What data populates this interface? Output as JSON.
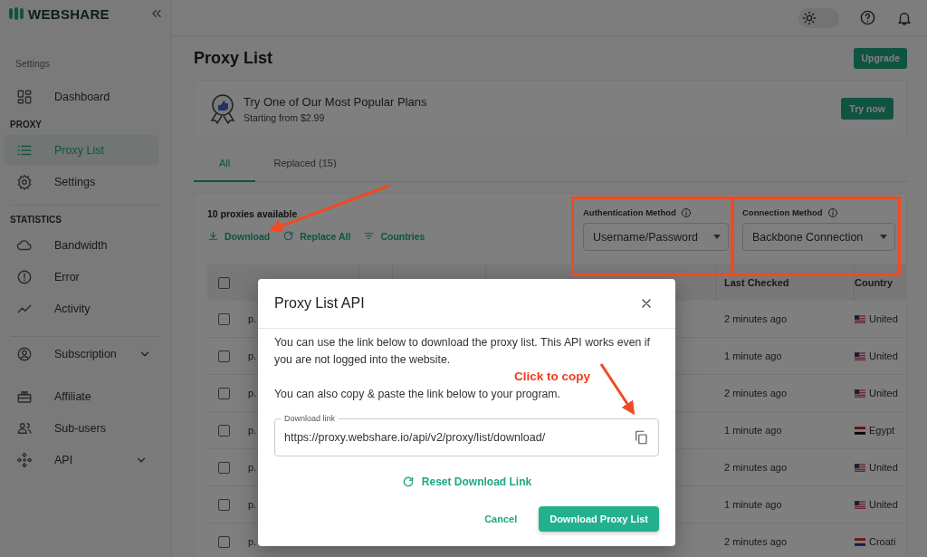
{
  "brand": {
    "name": "WEBSHARE"
  },
  "sidebar": {
    "heading": "Settings",
    "sections": [
      {
        "divider_above": false,
        "items": [
          {
            "label": "Dashboard",
            "kind": "dashboard",
            "selected": false,
            "expandable": false
          }
        ]
      },
      {
        "title": "PROXY",
        "divider_above": false,
        "items": [
          {
            "label": "Proxy List",
            "kind": "list",
            "selected": true,
            "expandable": false
          },
          {
            "label": "Settings",
            "kind": "gear",
            "selected": false,
            "expandable": false
          }
        ]
      },
      {
        "title": "STATISTICS",
        "divider_above": true,
        "items": [
          {
            "label": "Bandwidth",
            "kind": "cloud",
            "selected": false,
            "expandable": false
          },
          {
            "label": "Error",
            "kind": "alert",
            "selected": false,
            "expandable": false
          },
          {
            "label": "Activity",
            "kind": "trend",
            "selected": false,
            "expandable": false
          }
        ]
      },
      {
        "divider_above": true,
        "items": [
          {
            "label": "Subscription",
            "kind": "user",
            "selected": false,
            "expandable": true
          }
        ]
      },
      {
        "divider_above": false,
        "items": [
          {
            "label": "Affiliate",
            "kind": "gift",
            "selected": false,
            "expandable": false
          },
          {
            "label": "Sub-users",
            "kind": "users",
            "selected": false,
            "expandable": false
          },
          {
            "label": "API",
            "kind": "api",
            "selected": false,
            "expandable": true
          }
        ]
      }
    ]
  },
  "topbar": {
    "dark_mode": false
  },
  "page": {
    "title": "Proxy List",
    "upgrade_button": "Upgrade"
  },
  "promo": {
    "title": "Try One of Our Most Popular Plans",
    "subtitle": "Starting from $2.99",
    "button": "Try now"
  },
  "tabs": [
    {
      "label": "All",
      "selected": true
    },
    {
      "label": "Replaced (15)",
      "selected": false
    }
  ],
  "toolbar": {
    "count": "10 proxies available",
    "actions": [
      {
        "label": "Download",
        "kind": "download"
      },
      {
        "label": "Replace All",
        "kind": "refresh"
      },
      {
        "label": "Countries",
        "kind": "filter"
      }
    ]
  },
  "dropdowns": [
    {
      "label": "Authentication Method",
      "value": "Username/Password",
      "highlighted": true
    },
    {
      "label": "Connection Method",
      "value": "Backbone Connection",
      "highlighted": true
    }
  ],
  "table": {
    "select_all_checked": false,
    "columns": [
      "Last Checked",
      "Country"
    ],
    "rows": [
      {
        "selected": false,
        "address": "p.",
        "last_checked": "2 minutes ago",
        "kind": "us",
        "country": "United"
      },
      {
        "selected": false,
        "address": "p.",
        "last_checked": "1 minute ago",
        "kind": "us",
        "country": "United"
      },
      {
        "selected": false,
        "address": "p.",
        "last_checked": "2 minutes ago",
        "kind": "us",
        "country": "United"
      },
      {
        "selected": false,
        "address": "p.",
        "last_checked": "1 minute ago",
        "kind": "eg",
        "country": "Egypt"
      },
      {
        "selected": false,
        "address": "p.",
        "last_checked": "2 minutes ago",
        "kind": "us",
        "country": "United"
      },
      {
        "selected": false,
        "address": "p.",
        "last_checked": "1 minute ago",
        "kind": "us",
        "country": "United"
      },
      {
        "selected": false,
        "address": "p.",
        "last_checked": "2 minutes ago",
        "kind": "hr",
        "country": "Croati"
      }
    ]
  },
  "modal": {
    "title": "Proxy List API",
    "paragraphs": [
      "You can use the link below to download the proxy list. This API works even if you are not logged into the website.",
      "You can also copy & paste the link below to your program."
    ],
    "field": {
      "label": "Download link",
      "value": "https://proxy.webshare.io/api/v2/proxy/list/download/"
    },
    "reset_link": "Reset Download Link",
    "cancel_button": "Cancel",
    "primary_button": "Download Proxy List"
  },
  "annotations": {
    "callout": "Click to copy"
  }
}
